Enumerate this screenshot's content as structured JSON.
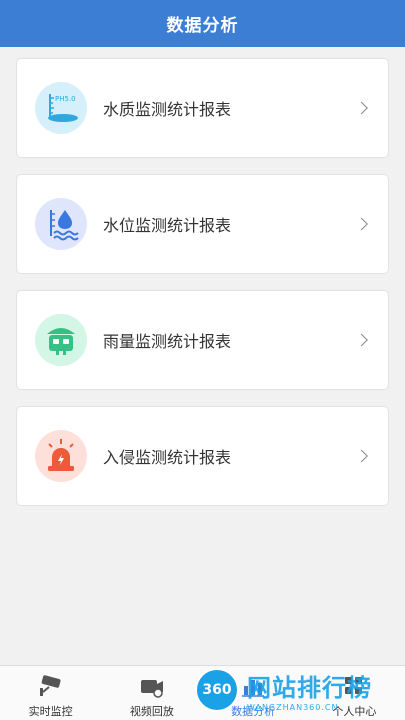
{
  "header": {
    "title": "数据分析"
  },
  "reports": [
    {
      "label": "水质监测统计报表",
      "icon": "water-quality-icon",
      "bg": "#d6f0fb",
      "accent": "#2ea8de",
      "icon_text": "PH5.0"
    },
    {
      "label": "水位监测统计报表",
      "icon": "water-level-icon",
      "bg": "#dfe6fb",
      "accent": "#3a78e0"
    },
    {
      "label": "雨量监测统计报表",
      "icon": "rainfall-icon",
      "bg": "#d3f6e6",
      "accent": "#34c183"
    },
    {
      "label": "入侵监测统计报表",
      "icon": "alarm-icon",
      "bg": "#fde0da",
      "accent": "#ef5a3c"
    }
  ],
  "tabbar": {
    "items": [
      {
        "label": "实时监控",
        "icon": "camera-icon"
      },
      {
        "label": "视频回放",
        "icon": "video-playback-icon"
      },
      {
        "label": "数据分析",
        "icon": "data-analysis-icon",
        "active": true
      },
      {
        "label": "个人中心",
        "icon": "user-center-icon"
      }
    ]
  },
  "watermark": {
    "badge": "360",
    "main": "网站排行榜",
    "sub": "WANGZHAN360.CN"
  },
  "colors": {
    "primary": "#3c7ed3",
    "background": "#f1f1f1"
  }
}
